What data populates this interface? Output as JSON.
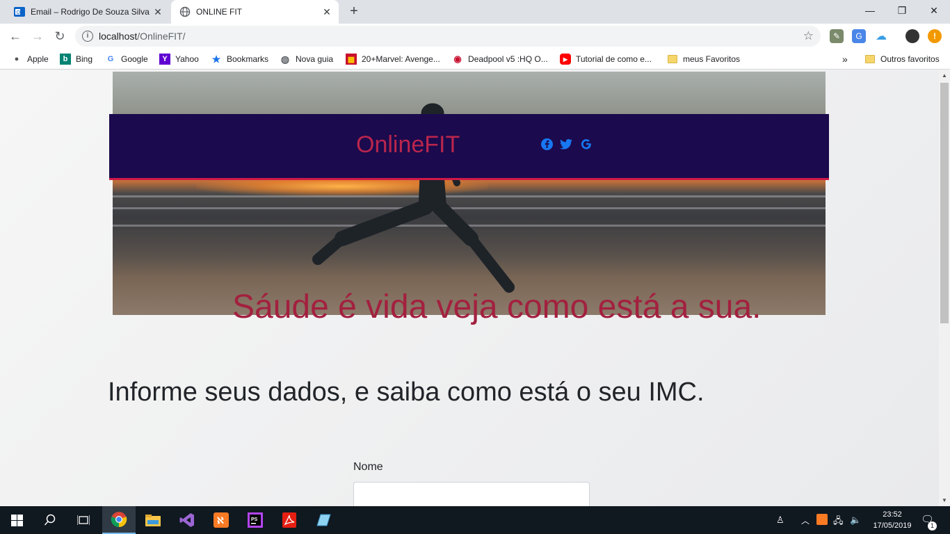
{
  "browser": {
    "tabs": [
      {
        "title": "Email – Rodrigo De Souza Silva –",
        "icon": "outlook-icon"
      },
      {
        "title": "ONLINE FIT",
        "icon": "globe-icon"
      }
    ],
    "new_tab": "+",
    "url_host": "localhost",
    "url_path": "/OnlineFIT/",
    "bookmarks": [
      {
        "label": "Apple",
        "icon": "apple-icon"
      },
      {
        "label": "Bing",
        "icon": "bing-icon"
      },
      {
        "label": "Google",
        "icon": "google-icon"
      },
      {
        "label": "Yahoo",
        "icon": "yahoo-icon"
      },
      {
        "label": "Bookmarks",
        "icon": "star-icon"
      },
      {
        "label": "Nova guia",
        "icon": "globe-icon"
      },
      {
        "label": "20+Marvel: Avenge...",
        "icon": "comic-icon"
      },
      {
        "label": "Deadpool v5 :HQ O...",
        "icon": "deadpool-icon"
      },
      {
        "label": "Tutorial de como e...",
        "icon": "youtube-icon"
      },
      {
        "label": "meus Favoritos",
        "icon": "folder-icon"
      }
    ],
    "overflow": "»",
    "other_bookmarks": "Outros favoritos"
  },
  "page": {
    "brand": "OnlineFIT",
    "social": [
      "facebook-icon",
      "twitter-icon",
      "google-icon"
    ],
    "tagline": "Sáude é vida veja como está a sua.",
    "subtitle": "Informe seus dados, e saiba como está o seu IMC.",
    "form": {
      "name_label": "Nome",
      "name_value": ""
    }
  },
  "taskbar": {
    "time": "23:52",
    "date": "17/05/2019",
    "notification_count": "1"
  },
  "colors": {
    "navbar": "#1b0a4d",
    "accent": "#d11a48",
    "brand_text": "#b9254d",
    "social_icons": "#1877f2"
  }
}
